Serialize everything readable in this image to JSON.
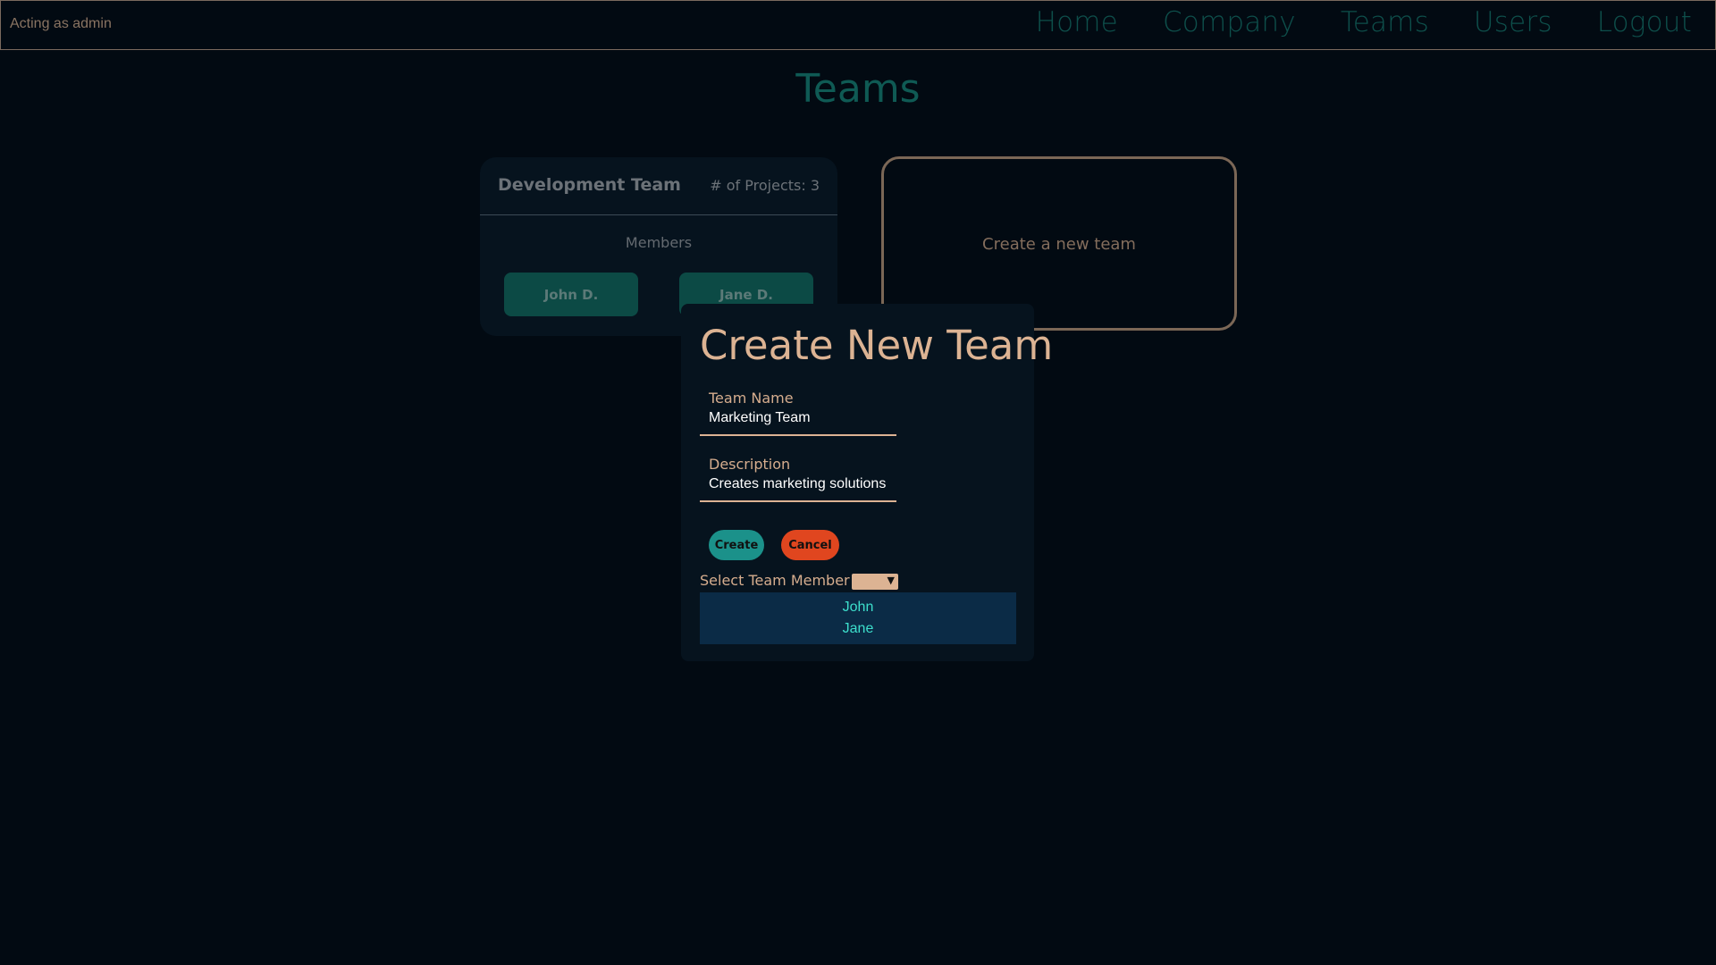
{
  "navbar": {
    "acting_as": "Acting as admin",
    "links": [
      "Home",
      "Company",
      "Teams",
      "Users",
      "Logout"
    ]
  },
  "page": {
    "title": "Teams"
  },
  "team_card": {
    "name": "Development Team",
    "projects": "# of Projects: 3",
    "members_label": "Members",
    "members": [
      "John D.",
      "Jane D."
    ]
  },
  "create_card": {
    "label": "Create a new team"
  },
  "modal": {
    "title": "Create New Team",
    "team_name_label": "Team Name",
    "team_name_value": "Marketing Team",
    "description_label": "Description",
    "description_value": "Creates marketing solutions",
    "create_label": "Create",
    "cancel_label": "Cancel",
    "select_label": "Select Team Member",
    "member_options": [
      "John",
      "Jane"
    ]
  },
  "colors": {
    "background": "#020a12",
    "accent_teal": "#1b918a",
    "accent_tan": "#dcb393",
    "cancel_red": "#e0461f",
    "option_text": "#3ddfcc"
  }
}
